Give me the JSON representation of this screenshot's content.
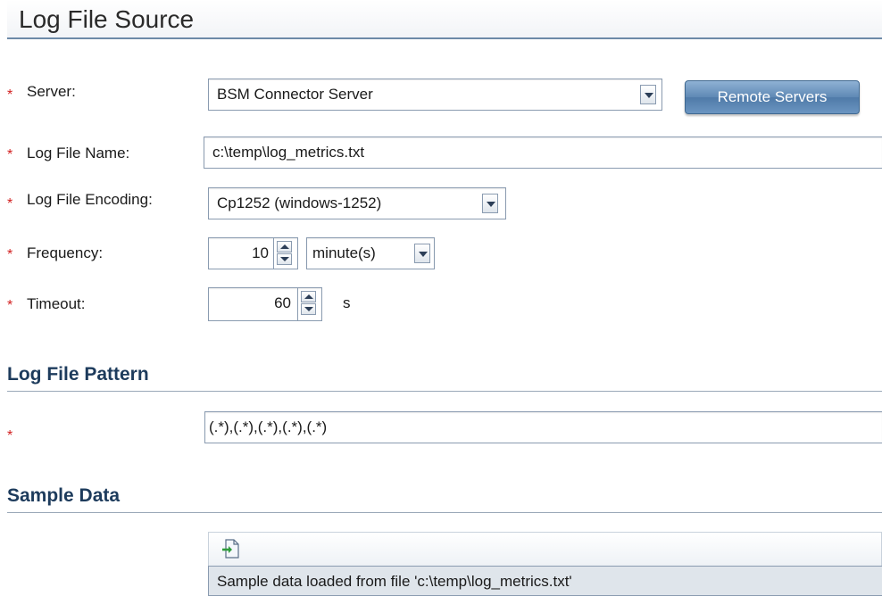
{
  "page": {
    "title": "Log File Source"
  },
  "fields": {
    "server": {
      "label": "Server:",
      "value": "BSM Connector Server",
      "button": "Remote Servers"
    },
    "log_file_name": {
      "label": "Log File Name:",
      "value": "c:\\temp\\log_metrics.txt"
    },
    "encoding": {
      "label": "Log File Encoding:",
      "value": "Cp1252 (windows-1252)"
    },
    "frequency": {
      "label": "Frequency:",
      "value": "10",
      "unit": "minute(s)"
    },
    "timeout": {
      "label": "Timeout:",
      "value": "60",
      "unit": "s"
    }
  },
  "required_marker": "*",
  "pattern_section": {
    "title": "Log File Pattern",
    "value": "(.*),(.*),(.*),(.*),(.*)"
  },
  "sample_section": {
    "title": "Sample Data",
    "load_icon": "load-sample-file-icon",
    "status": "Sample data loaded from file 'c:\\temp\\log_metrics.txt'"
  },
  "colors": {
    "required": "#d21f1f",
    "section_heading": "#1d3b5c",
    "button_blue": "#5f89b5"
  }
}
